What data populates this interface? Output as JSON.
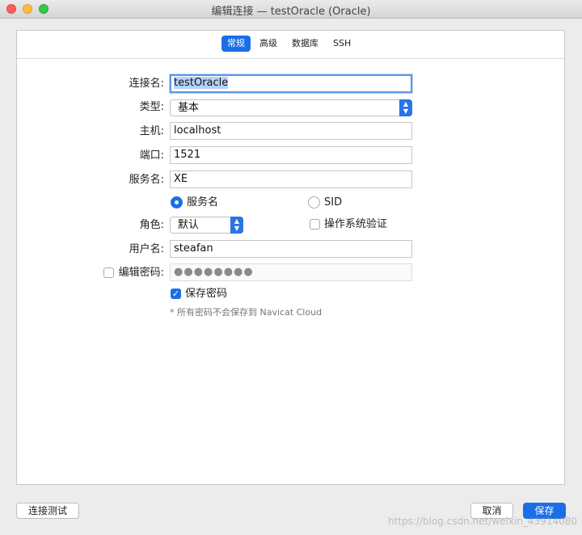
{
  "window": {
    "title": "编辑连接 — testOracle (Oracle)"
  },
  "tabs": [
    {
      "label": "常规",
      "active": true
    },
    {
      "label": "高级",
      "active": false
    },
    {
      "label": "数据库",
      "active": false
    },
    {
      "label": "SSH",
      "active": false
    }
  ],
  "form": {
    "connection_name": {
      "label": "连接名:",
      "value": "testOracle"
    },
    "type": {
      "label": "类型:",
      "value": "基本"
    },
    "host": {
      "label": "主机:",
      "value": "localhost"
    },
    "port": {
      "label": "端口:",
      "value": "1521"
    },
    "service_name": {
      "label": "服务名:",
      "value": "XE"
    },
    "radio_service": {
      "label": "服务名",
      "checked": true
    },
    "radio_sid": {
      "label": "SID",
      "checked": false
    },
    "role": {
      "label": "角色:",
      "value": "默认"
    },
    "os_auth": {
      "label": "操作系统验证",
      "checked": false
    },
    "username": {
      "label": "用户名:",
      "value": "steafan"
    },
    "edit_password": {
      "label": "编辑密码:",
      "checked": false,
      "value": "●●●●●●●●"
    },
    "save_password": {
      "label": "保存密码",
      "checked": true
    },
    "note": "* 所有密码不会保存到 Navicat Cloud"
  },
  "buttons": {
    "test": "连接测试",
    "cancel": "取消",
    "save": "保存"
  },
  "watermark": "https://blog.csdn.net/weixin_43914080",
  "colors": {
    "accent": "#1b6fe6"
  }
}
